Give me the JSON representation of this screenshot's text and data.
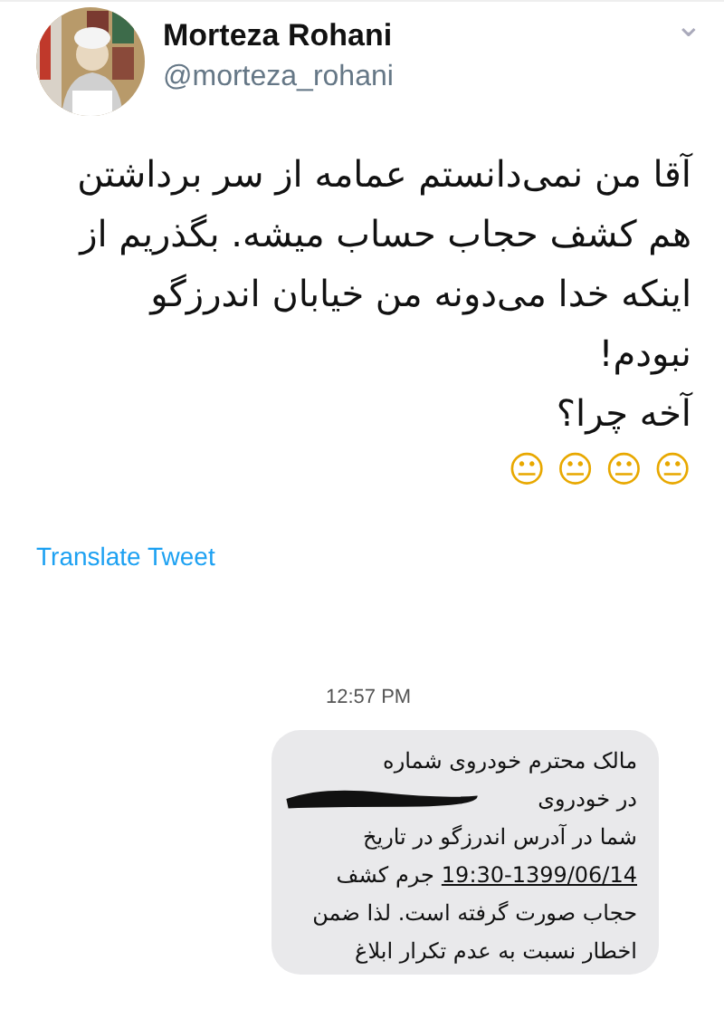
{
  "author": {
    "name": "Morteza Rohani",
    "handle": "@morteza_rohani"
  },
  "menu_icon": "⌄",
  "tweet_lines": [
    "آقا من نمی‌دانستم عمامه از سر برداشتن",
    "هم کشف حجاب حساب میشه. بگذریم از",
    "اینکه خدا می‌دونه من خیابان اندرزگو",
    "نبودم!",
    "آخه چرا؟"
  ],
  "emoji": [
    "😐",
    "😐",
    "😐",
    "😐"
  ],
  "translate_link": "Translate Tweet",
  "attached_screenshot": {
    "time": "12:57 PM",
    "message_lines": [
      {
        "text": "مالک محترم خودروی شماره",
        "redacted": false,
        "underlined": false
      },
      {
        "text": "در خودروی",
        "redacted": true,
        "underlined": false
      },
      {
        "text": "شما  در آدرس اندرزگو در تاریخ",
        "redacted": false,
        "underlined": false
      },
      {
        "text": "19:30-1399/06/14",
        "redacted": false,
        "underlined": true,
        "after": "جرم کشف"
      },
      {
        "text": "حجاب صورت گرفته است. لذا ضمن",
        "redacted": false,
        "underlined": false
      },
      {
        "text": "اخطار نسبت به عدم تکرار ابلاغ",
        "redacted": false,
        "underlined": false
      }
    ]
  }
}
